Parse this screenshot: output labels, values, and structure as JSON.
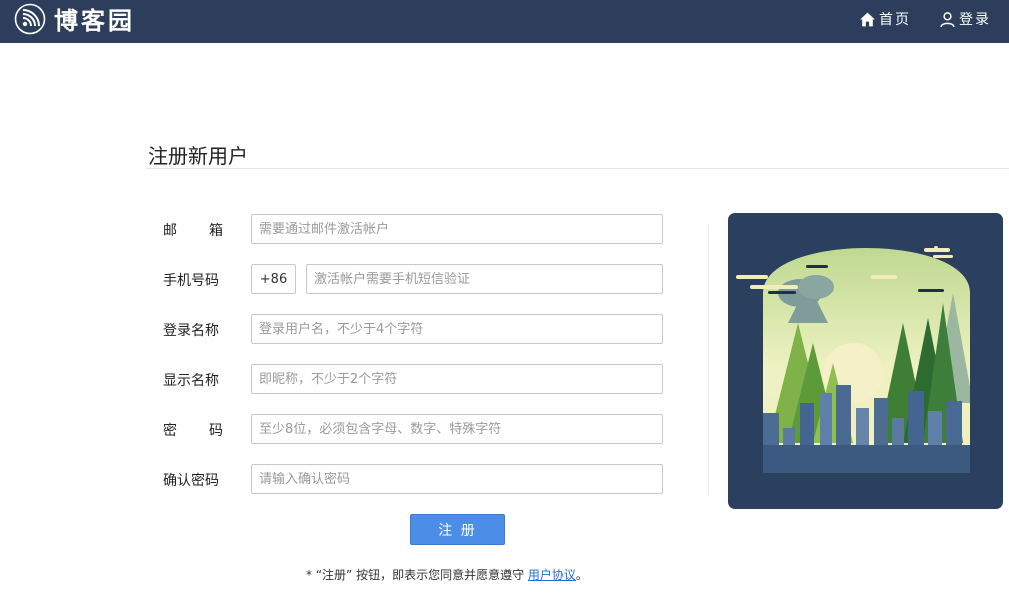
{
  "header": {
    "logo_text": "博客园",
    "nav": [
      {
        "label": "首页",
        "icon": "home-icon"
      },
      {
        "label": "登录",
        "icon": "user-icon"
      }
    ]
  },
  "page": {
    "title": "注册新用户"
  },
  "form": {
    "email": {
      "label_a": "邮",
      "label_b": "箱",
      "placeholder": "需要通过邮件激活帐户"
    },
    "phone": {
      "label": "手机号码",
      "prefix": "+86",
      "placeholder": "激活帐户需要手机短信验证"
    },
    "login_name": {
      "label": "登录名称",
      "placeholder": "登录用户名，不少于4个字符"
    },
    "display_name": {
      "label": "显示名称",
      "placeholder": "即昵称，不少于2个字符"
    },
    "password": {
      "label_a": "密",
      "label_b": "码",
      "placeholder": "至少8位，必须包含字母、数字、特殊字符"
    },
    "confirm_password": {
      "label": "确认密码",
      "placeholder": "请输入确认密码"
    },
    "submit_label": "注 册"
  },
  "agreement": {
    "text": "* “注册” 按钮，即表示您同意并愿意遵守 ",
    "link": "用户协议",
    "suffix": "。"
  },
  "colors": {
    "header_bg": "#2c3e5c",
    "button_bg": "#4c8de8",
    "link": "#1a6fd8"
  }
}
